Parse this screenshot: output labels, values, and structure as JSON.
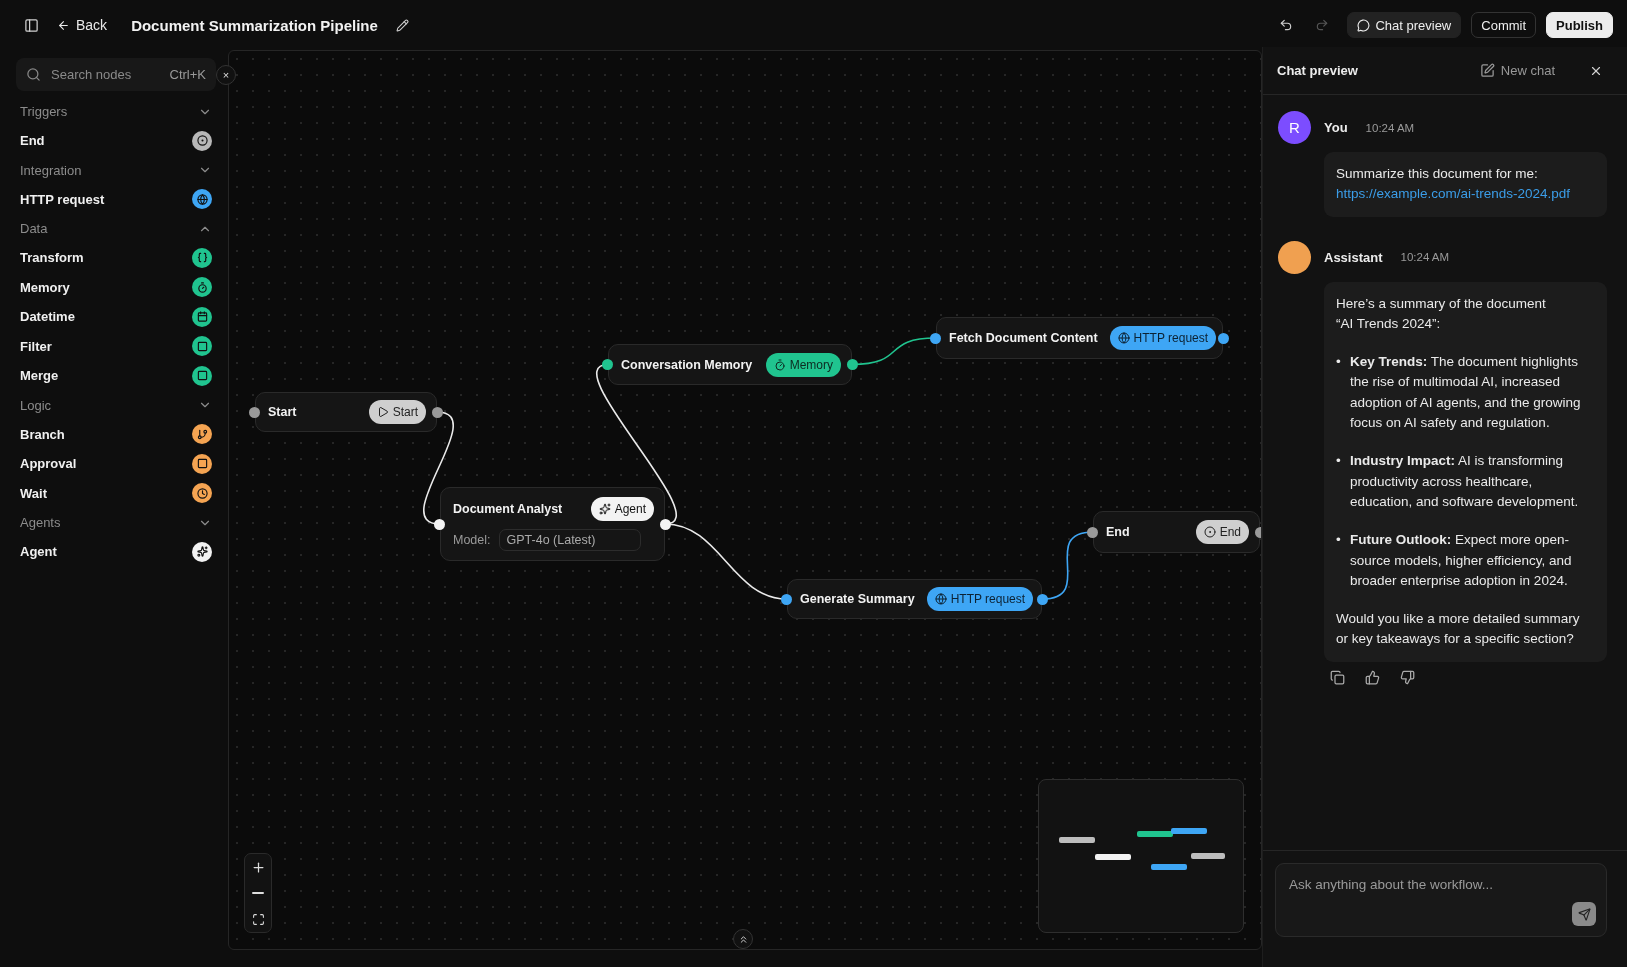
{
  "header": {
    "back": "Back",
    "title": "Document Summarization Pipeline",
    "undo": {
      "disabled": false
    },
    "redo": {
      "disabled": true
    },
    "chat_preview": "Chat preview",
    "commit": "Commit",
    "publish": "Publish"
  },
  "sidebar": {
    "search": {
      "placeholder": "Search nodes",
      "shortcut": "Ctrl+K",
      "close": "×"
    },
    "groups": [
      {
        "label": "Triggers",
        "expanded": false,
        "items": [
          {
            "label": "End",
            "kind": "end",
            "color": "#b8b8b8"
          }
        ]
      },
      {
        "label": "Integration",
        "expanded": false,
        "items": [
          {
            "label": "HTTP request",
            "kind": "http",
            "color": "#3ea6f5"
          }
        ]
      },
      {
        "label": "Data",
        "expanded": true,
        "items": [
          {
            "label": "Transform",
            "kind": "transform",
            "color": "#20c48f"
          },
          {
            "label": "Memory",
            "kind": "memory",
            "color": "#20c48f"
          },
          {
            "label": "Datetime",
            "kind": "datetime",
            "color": "#20c48f"
          },
          {
            "label": "Filter",
            "kind": "filter",
            "color": "#20c48f"
          },
          {
            "label": "Merge",
            "kind": "merge",
            "color": "#20c48f"
          }
        ]
      },
      {
        "label": "Logic",
        "expanded": false,
        "items": [
          {
            "label": "Branch",
            "kind": "branch",
            "color": "#f5a452"
          },
          {
            "label": "Approval",
            "kind": "approval",
            "color": "#f5a452"
          },
          {
            "label": "Wait",
            "kind": "wait",
            "color": "#f5a452"
          }
        ]
      },
      {
        "label": "Agents",
        "expanded": false,
        "items": [
          {
            "label": "Agent",
            "kind": "agent",
            "color": "#f2f2f2"
          }
        ]
      }
    ]
  },
  "canvas": {
    "nodes": [
      {
        "title": "Start",
        "kind": "start",
        "badge": "Start"
      },
      {
        "title": "Document Analyst",
        "kind": "agent",
        "badge": "Agent",
        "model_label": "Model:",
        "model": "GPT-4o (Latest)"
      },
      {
        "title": "Conversation Memory",
        "kind": "memory",
        "badge": "Memory"
      },
      {
        "title": "Fetch Document Content",
        "kind": "http",
        "badge": "HTTP request"
      },
      {
        "title": "Generate Summary",
        "kind": "http",
        "badge": "HTTP request"
      },
      {
        "title": "End",
        "kind": "end",
        "badge": "End"
      }
    ]
  },
  "chat": {
    "title": "Chat preview",
    "new_chat": "New chat",
    "messages": [
      {
        "kind": "user",
        "author": "You",
        "avatar": "R",
        "time": "10:24 AM",
        "text": "Summarize this document for me:",
        "link": "https://example.com/ai-trends-2024.pdf"
      },
      {
        "kind": "assistant",
        "author": "Assistant",
        "time": "10:24 AM",
        "intro": [
          "Here’s a summary of the document",
          "“AI Trends 2024”:"
        ],
        "bullets": [
          {
            "marker": "•",
            "text": "**Key Trends:** The document highlights the rise of multimodal AI, increased adoption of AI agents, and the growing focus on AI safety and regulation."
          },
          {
            "marker": "•",
            "text": "**Industry Impact:** AI is transforming productivity across healthcare, education, and software development."
          },
          {
            "marker": "•",
            "text": "**Future Outlook:** Expect more open-source models, higher efficiency, and broader enterprise adoption in 2024."
          }
        ],
        "closing": "Would you like a more detailed summary or key takeaways for a specific section?"
      }
    ],
    "input": {
      "placeholder": "Ask anything about the workflow..."
    }
  }
}
